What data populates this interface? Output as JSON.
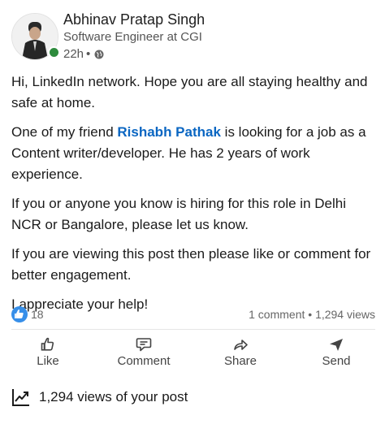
{
  "author": {
    "name": "Abhinav Pratap Singh",
    "headline": "Software Engineer at CGI",
    "time": "22h",
    "separator": "•"
  },
  "post": {
    "p1": "Hi, LinkedIn network. Hope you are all staying healthy and safe at home.",
    "p2_before": "One of my friend ",
    "p2_mention": "Rishabh Pathak",
    "p2_after": " is looking for a job as a Content writer/developer. He has 2 years of work experience.",
    "p3": "If you or anyone you know is hiring for this role in Delhi NCR or Bangalore, please let us know.",
    "p4": "If you are viewing this post then please like or comment for better engagement.",
    "p5": "I appreciate your help!"
  },
  "stats": {
    "reactions": "18",
    "comments": "1 comment",
    "dot": "•",
    "views": "1,294 views"
  },
  "actions": {
    "like": "Like",
    "comment": "Comment",
    "share": "Share",
    "send": "Send"
  },
  "footer": {
    "views_text": "1,294 views of your post"
  },
  "colors": {
    "accent": "#0a66c2",
    "like_blue": "#378fe9",
    "online_green": "#2e8b3d"
  }
}
